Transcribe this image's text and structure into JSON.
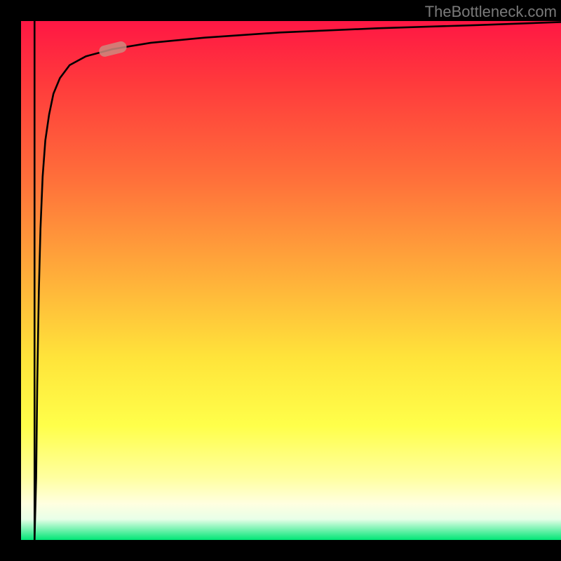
{
  "watermark": "TheBottleneck.com",
  "chart_data": {
    "type": "line",
    "title": "",
    "xlabel": "",
    "ylabel": "",
    "xlim": [
      0,
      100
    ],
    "ylim": [
      0,
      100
    ],
    "grid": false,
    "gradient_stops": [
      {
        "offset": 0.0,
        "color": "#ff1744"
      },
      {
        "offset": 0.12,
        "color": "#ff3a3c"
      },
      {
        "offset": 0.3,
        "color": "#ff6e3a"
      },
      {
        "offset": 0.5,
        "color": "#ffb13a"
      },
      {
        "offset": 0.65,
        "color": "#ffe43a"
      },
      {
        "offset": 0.78,
        "color": "#ffff4a"
      },
      {
        "offset": 0.88,
        "color": "#ffffa0"
      },
      {
        "offset": 0.93,
        "color": "#ffffe0"
      },
      {
        "offset": 0.96,
        "color": "#e8ffe8"
      },
      {
        "offset": 1.0,
        "color": "#00e676"
      }
    ],
    "series": [
      {
        "name": "curve",
        "x": [
          2.5,
          2.8,
          3.0,
          3.3,
          3.6,
          4.0,
          4.5,
          5.2,
          6.0,
          7.2,
          9.0,
          12.0,
          17.0,
          24.0,
          34.0,
          48.0,
          66.0,
          84.0,
          100.0
        ],
        "y": [
          0.0,
          12.0,
          30.0,
          48.0,
          60.0,
          70.0,
          77.0,
          82.0,
          86.0,
          89.0,
          91.5,
          93.2,
          94.6,
          95.8,
          96.8,
          97.8,
          98.6,
          99.2,
          99.8
        ]
      },
      {
        "name": "drop",
        "x": [
          2.5,
          2.5
        ],
        "y": [
          100.0,
          0.0
        ]
      }
    ],
    "marker": {
      "x": 17.0,
      "y": 94.6,
      "angle_deg": 14
    }
  }
}
